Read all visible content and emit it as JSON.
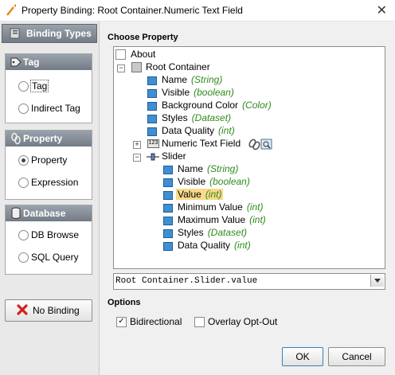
{
  "window": {
    "title": "Property Binding: Root Container.Numeric Text Field",
    "close_glyph": "✕"
  },
  "sidebar": {
    "header": "Binding Types",
    "groups": [
      {
        "title": "Tag",
        "options": [
          "Tag",
          "Indirect Tag"
        ],
        "selected": 0
      },
      {
        "title": "Property",
        "options": [
          "Property",
          "Expression"
        ],
        "selected": 0
      },
      {
        "title": "Database",
        "options": [
          "DB Browse",
          "SQL Query"
        ],
        "selected": -1
      }
    ],
    "no_binding_label": "No Binding"
  },
  "main": {
    "choose_property_label": "Choose Property",
    "tree": {
      "about": "About",
      "root": "Root Container",
      "root_props": [
        {
          "name": "Name",
          "type": "(String)"
        },
        {
          "name": "Visible",
          "type": "(boolean)"
        },
        {
          "name": "Background Color",
          "type": "(Color)"
        },
        {
          "name": "Styles",
          "type": "(Dataset)"
        },
        {
          "name": "Data Quality",
          "type": "(int)"
        }
      ],
      "numeric_text_field": "Numeric Text Field",
      "slider": "Slider",
      "slider_props": [
        {
          "name": "Name",
          "type": "(String)"
        },
        {
          "name": "Visible",
          "type": "(boolean)"
        },
        {
          "name": "Value",
          "type": "(int)"
        },
        {
          "name": "Minimum Value",
          "type": "(int)"
        },
        {
          "name": "Maximum Value",
          "type": "(int)"
        },
        {
          "name": "Styles",
          "type": "(Dataset)"
        },
        {
          "name": "Data Quality",
          "type": "(int)"
        }
      ]
    },
    "selected_path": "Root Container.Slider.value",
    "options_label": "Options",
    "bidirectional_label": "Bidirectional",
    "bidirectional_checked": true,
    "overlay_opt_out_label": "Overlay Opt-Out",
    "overlay_opt_out_checked": false
  },
  "footer": {
    "ok_label": "OK",
    "cancel_label": "Cancel"
  },
  "colors": {
    "type_text": "#2e8b1e",
    "selection": "#f9d98a",
    "header_gradient_top": "#9aa3ad"
  }
}
